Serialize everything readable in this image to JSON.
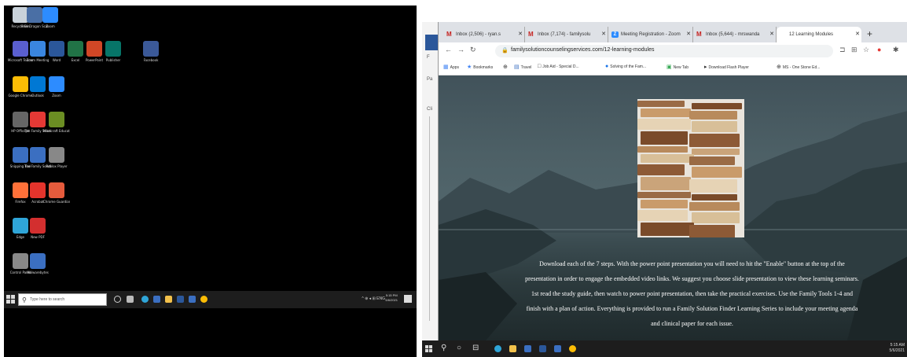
{
  "left_desktop": {
    "icons": [
      {
        "label": "Recycle Bin",
        "color": "#c9d2da"
      },
      {
        "label": "Blue Dragon Scanner Tool",
        "color": "#4a6fa5"
      },
      {
        "label": "Zoom",
        "color": "#2d8cff"
      },
      {
        "label": "Microsoft Teams",
        "color": "#5a5fd0"
      },
      {
        "label": "Zoom Meeting",
        "color": "#3a86e0"
      },
      {
        "label": "Word",
        "color": "#2b579a"
      },
      {
        "label": "Excel",
        "color": "#217346"
      },
      {
        "label": "PowerPoint",
        "color": "#d24726"
      },
      {
        "label": "Publisher",
        "color": "#077568"
      },
      {
        "label": "Facebook",
        "color": "#3b5998"
      },
      {
        "label": "Google Chrome",
        "color": "#fbbc05"
      },
      {
        "label": "Outlook",
        "color": "#0078d4"
      },
      {
        "label": "Zoom",
        "color": "#2d8cff"
      },
      {
        "label": "HP Officejet",
        "color": "#666666"
      },
      {
        "label": "The Family Solution",
        "color": "#e53935"
      },
      {
        "label": "Minecraft Education",
        "color": "#6b8e23"
      },
      {
        "label": "Snipping Tool",
        "color": "#3b6fc1"
      },
      {
        "label": "The Family Solution",
        "color": "#3b6fc1"
      },
      {
        "label": "Roblox Player",
        "color": "#888888"
      },
      {
        "label": "Firefox",
        "color": "#ff7139"
      },
      {
        "label": "Acrobat",
        "color": "#e4342c"
      },
      {
        "label": "Chrome Guardian",
        "color": "#e55b3c"
      },
      {
        "label": "Edge",
        "color": "#2fa5d8"
      },
      {
        "label": "New PDF",
        "color": "#d32f2f"
      },
      {
        "label": "Control Panel",
        "color": "#888888"
      },
      {
        "label": "Malwarebytes",
        "color": "#3b6fc1"
      }
    ],
    "taskbar": {
      "search_placeholder": "Type here to search",
      "clock_time": "5:15 PM",
      "clock_date": "5/6/2021",
      "tray_text": "^ ⊕ ◂ ⊞ ENG"
    }
  },
  "word_strip": {
    "letters": [
      "F",
      "Pa",
      "Cli"
    ]
  },
  "browser": {
    "tabs": [
      {
        "title": "Inbox (2,506) - ryan.s",
        "favicon": "M"
      },
      {
        "title": "Inbox (7,174) - familysolu",
        "favicon": "M"
      },
      {
        "title": "Meeting Registration - Zoom",
        "favicon": "Z"
      },
      {
        "title": "Inbox (5,644) - mrswanda",
        "favicon": "M"
      },
      {
        "title": "12 Learning Modules",
        "favicon": "",
        "active": true
      }
    ],
    "url": "familysolutioncounselingservices.com/12-learning-modules",
    "bookmarks": [
      {
        "label": "Apps",
        "glyph": "▦"
      },
      {
        "label": "Bookmarks",
        "glyph": "★"
      },
      {
        "label": "",
        "glyph": "⊕"
      },
      {
        "label": "Travel",
        "glyph": "▤"
      },
      {
        "label": "Job Aid - Special D...",
        "glyph": "□"
      },
      {
        "label": "Solving of the Fam...",
        "glyph": "●"
      },
      {
        "label": "New Tab",
        "glyph": "▣"
      },
      {
        "label": "Download Flash Player",
        "glyph": "▸"
      },
      {
        "label": "MS - One Stone Ed...",
        "glyph": "⊕"
      }
    ],
    "page": {
      "paragraphs": [
        "Download each of the 7 steps. With the power point presentation you will need to hit the \"Enable\" button at the top of the presentation in order to engage the embedded video links. We suggest you choose slide presentation to view these learning seminars.",
        "1st read the study guide, then watch to power point presentation, then take the practical exercises. Use the Family Tools 1-4 and finish with a plan of action. Everything is provided to run a Family Solution Finder Learning Series to include your meeting agenda and clinical paper for each issue."
      ]
    }
  },
  "right_taskbar": {
    "clock_time": "5:15 AM",
    "clock_date": "5/6/2021"
  }
}
